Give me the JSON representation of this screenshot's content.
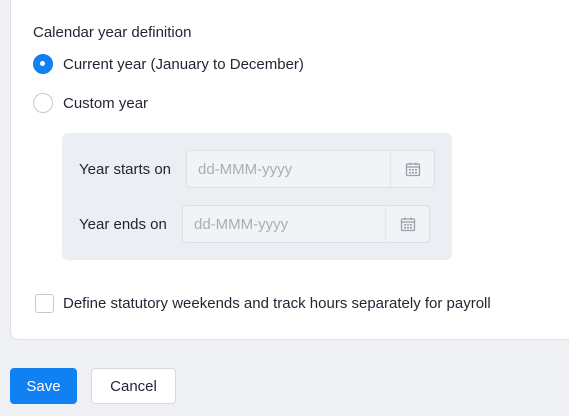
{
  "calendar": {
    "title": "Calendar year definition",
    "options": [
      {
        "label": "Current year (January to December)",
        "checked": true
      },
      {
        "label": "Custom year",
        "checked": false
      }
    ],
    "custom": {
      "start_label": "Year starts on",
      "start_placeholder": "dd-MMM-yyyy",
      "end_label": "Year ends on",
      "end_placeholder": "dd-MMM-yyyy"
    },
    "weekend_checkbox_label": "Define statutory weekends and track hours separately for payroll",
    "weekend_checked": false
  },
  "actions": {
    "save_label": "Save",
    "cancel_label": "Cancel"
  },
  "colors": {
    "accent": "#1180f3",
    "page_bg": "#eef0f4"
  }
}
